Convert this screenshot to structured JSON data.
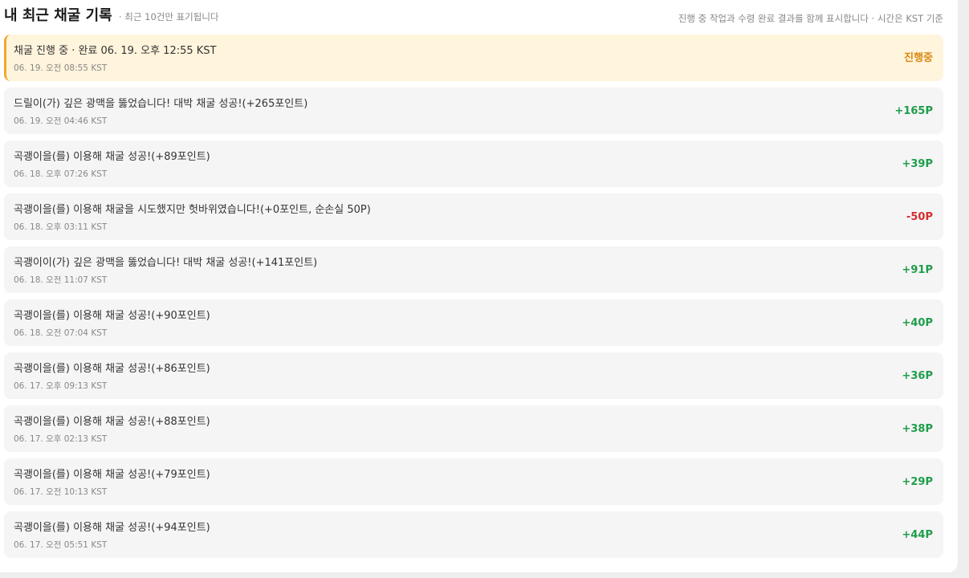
{
  "header": {
    "title": "내 최근 채굴 기록",
    "subtitle": "· 최근 10건만 표기됩니다",
    "info": "진행 중 작업과 수령 완료 결과를 함께 표시합니다 · 시간은 KST 기준"
  },
  "records": [
    {
      "message": "채굴 진행 중 · 완료 06. 19. 오후 12:55 KST",
      "time": "06. 19. 오전 08:55 KST",
      "result": "진행중",
      "status": "pending"
    },
    {
      "message": "드릴이(가) 깊은 광맥을 뚫었습니다! 대박 채굴 성공!(+265포인트)",
      "time": "06. 19. 오전 04:46 KST",
      "result": "+165P",
      "status": "pos"
    },
    {
      "message": "곡괭이을(를) 이용해 채굴 성공!(+89포인트)",
      "time": "06. 18. 오후 07:26 KST",
      "result": "+39P",
      "status": "pos"
    },
    {
      "message": "곡괭이을(를) 이용해 채굴을 시도했지만 헛바위였습니다!(+0포인트, 순손실 50P)",
      "time": "06. 18. 오후 03:11 KST",
      "result": "-50P",
      "status": "neg"
    },
    {
      "message": "곡괭이이(가) 깊은 광맥을 뚫었습니다! 대박 채굴 성공!(+141포인트)",
      "time": "06. 18. 오전 11:07 KST",
      "result": "+91P",
      "status": "pos"
    },
    {
      "message": "곡괭이을(를) 이용해 채굴 성공!(+90포인트)",
      "time": "06. 18. 오전 07:04 KST",
      "result": "+40P",
      "status": "pos"
    },
    {
      "message": "곡괭이을(를) 이용해 채굴 성공!(+86포인트)",
      "time": "06. 17. 오후 09:13 KST",
      "result": "+36P",
      "status": "pos"
    },
    {
      "message": "곡괭이을(를) 이용해 채굴 성공!(+88포인트)",
      "time": "06. 17. 오후 02:13 KST",
      "result": "+38P",
      "status": "pos"
    },
    {
      "message": "곡괭이을(를) 이용해 채굴 성공!(+79포인트)",
      "time": "06. 17. 오전 10:13 KST",
      "result": "+29P",
      "status": "pos"
    },
    {
      "message": "곡괭이을(를) 이용해 채굴 성공!(+94포인트)",
      "time": "06. 17. 오전 05:51 KST",
      "result": "+44P",
      "status": "pos"
    }
  ],
  "colors": {
    "positive": "#1f9d4a",
    "negative": "#d32f2f",
    "pending": "#d98a12",
    "pending_bg": "#fff4dc",
    "pending_border": "#f0a82a"
  }
}
